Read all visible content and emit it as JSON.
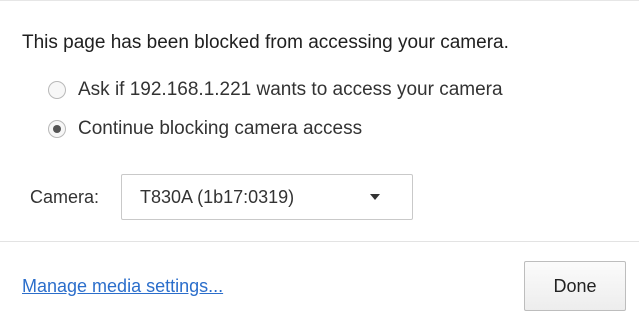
{
  "dialog": {
    "heading": "This page has been blocked from accessing your camera.",
    "options": [
      {
        "label": "Ask if 192.168.1.221 wants to access your camera",
        "selected": false
      },
      {
        "label": "Continue blocking camera access",
        "selected": true
      }
    ],
    "camera": {
      "label": "Camera:",
      "selected_value": "T830A (1b17:0319)",
      "dropdown_icon": "chevron-down-icon"
    },
    "footer": {
      "manage_link": "Manage media settings...",
      "done_label": "Done"
    }
  },
  "colors": {
    "link": "#2b6ecb",
    "border": "#c9c9c9",
    "text": "#222222"
  }
}
